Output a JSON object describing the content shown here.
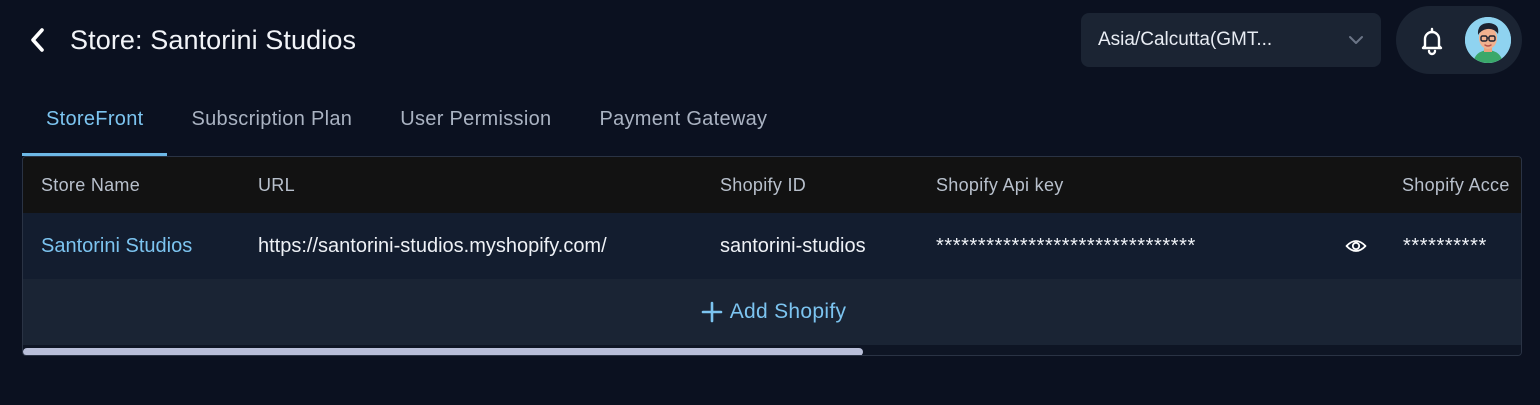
{
  "header": {
    "title": "Store: Santorini Studios",
    "back_icon": "chevron-left-icon"
  },
  "timezone": {
    "value": "Asia/Calcutta(GMT...",
    "icon": "chevron-down-icon"
  },
  "actions": {
    "notification_icon": "bell-icon",
    "avatar": "user-avatar"
  },
  "tabs": [
    {
      "label": "StoreFront",
      "active": true
    },
    {
      "label": "Subscription Plan",
      "active": false
    },
    {
      "label": "User Permission",
      "active": false
    },
    {
      "label": "Payment Gateway",
      "active": false
    }
  ],
  "table": {
    "columns": [
      "Store Name",
      "URL",
      "Shopify ID",
      "Shopify Api key",
      "Shopify Acce"
    ],
    "rows": [
      {
        "store_name": "Santorini Studios",
        "url": "https://santorini-studios.myshopify.com/",
        "shopify_id": "santorini-studios",
        "api_key": "*******************************",
        "access_token": "**********"
      }
    ],
    "add_label": "Add Shopify",
    "scroll_progress": 0.56
  },
  "colors": {
    "background": "#0b1120",
    "accent": "#7cc4f0",
    "header_row": "#121212",
    "body_row": "#131d2f"
  }
}
